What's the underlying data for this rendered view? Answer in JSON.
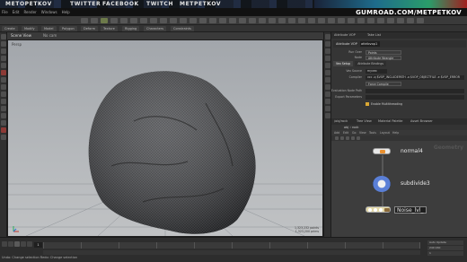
{
  "banner": {
    "titles": [
      "METOPETKOV",
      "TWITTER",
      "FACEBOOK",
      "TWITCH",
      "METPETKOV"
    ]
  },
  "gumroad": {
    "url": "GUMROAD.COM/METPETKOV",
    "menu": [
      "File",
      "Edit",
      "Render",
      "Windows",
      "Help"
    ]
  },
  "shelf": {
    "tabs": [
      "Create",
      "Modify",
      "Model",
      "Polygon",
      "Deform",
      "Texture",
      "Rigging",
      "Characters",
      "Constraints"
    ]
  },
  "viewport": {
    "header_label": "Scene View",
    "camera": "No cam",
    "perspective": "Persp",
    "corner_info": [
      "1,323,232  points",
      "1,323,200  prims"
    ]
  },
  "params": {
    "tabs": [
      "Attribute VOP",
      "Take List"
    ],
    "node_type": "Attribute VOP",
    "node_name": "attribvop1",
    "rows": [
      {
        "label": "Run Over",
        "value": "Points"
      },
      {
        "label": "Node",
        "value": "Attribute Wrangle"
      }
    ],
    "section_tabs": [
      "Vex Setup",
      "Attribute Bindings"
    ],
    "rows2": [
      {
        "label": "Vex Source",
        "value": "myvex"
      },
      {
        "label": "Compiler",
        "value": "vcc -q $VOP_INCLUDEPATH -o $VOP_OBJECTFILE -e $VOP_ERROR"
      },
      {
        "label": "",
        "value": "Force Compile"
      },
      {
        "label": "Evaluation Node Path",
        "value": ""
      },
      {
        "label": "Export Parameters",
        "value": ""
      }
    ],
    "multithread_label": "Enable Multithreading"
  },
  "network": {
    "tabs": [
      "/obj/rock",
      "Tree View",
      "Material Palette",
      "Asset Browser"
    ],
    "path": "obj › rock",
    "menu": [
      "Add",
      "Edit",
      "Go",
      "View",
      "Tools",
      "Layout",
      "Help"
    ],
    "watermark": "Geometry",
    "nodes": [
      {
        "name": "normal4",
        "color": "#e8e8e8"
      },
      {
        "name": "subdivide3",
        "color": "#5a7fd6"
      },
      {
        "name": "Noise_lvl_",
        "color": "#e3d9a6"
      }
    ]
  },
  "timeline": {
    "frame": "1",
    "status": "Undo: Change selection   Redo: Change selection",
    "right_controls": [
      "Auto Update",
      "240  240",
      "1"
    ]
  }
}
